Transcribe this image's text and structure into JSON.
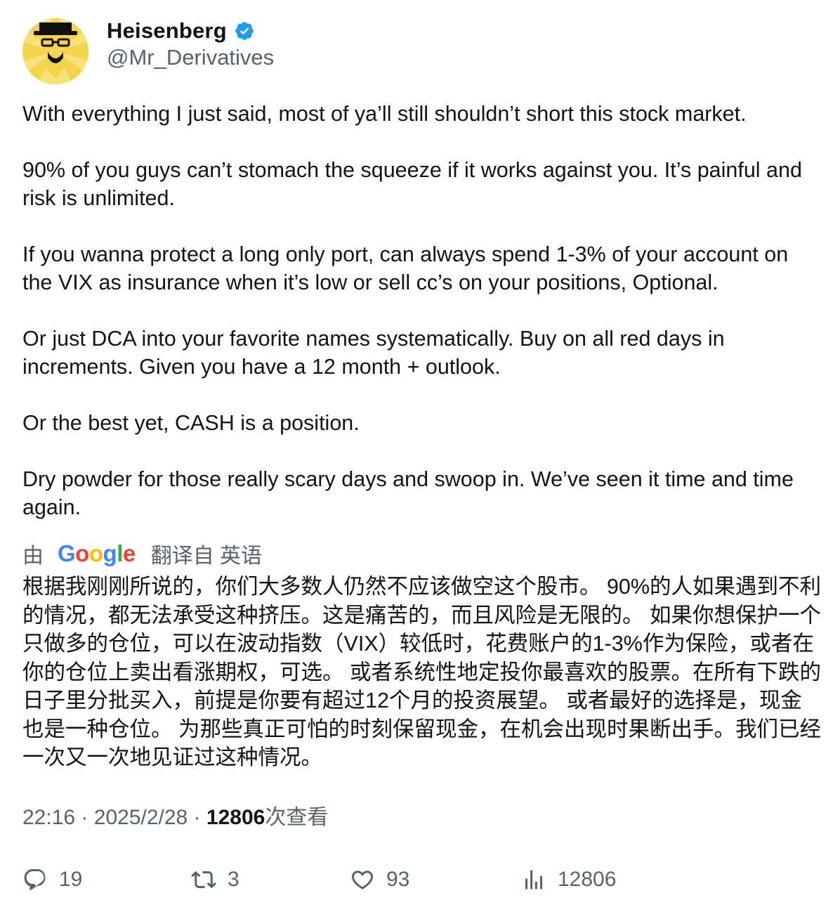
{
  "author": {
    "display_name": "Heisenberg",
    "handle": "@Mr_Derivatives",
    "verified": true,
    "verified_color": "#1d9bf0",
    "avatar_icon": "heisenberg-avatar"
  },
  "tweet": {
    "text": "With everything I just said, most of ya’ll still shouldn’t short this stock market.\n\n90% of you guys can’t stomach the squeeze if it works against you. It’s painful and risk is unlimited.\n\nIf you wanna protect a long only port, can always spend 1-3% of your account on the VIX as insurance when it’s low or sell cc’s on your positions, Optional.\n\nOr just DCA into your favorite names systematically. Buy on all red days in increments. Given you have a 12 month + outlook.\n\nOr the best yet, CASH is a position.\n\nDry powder for those really scary days and swoop in. We’ve seen it time and time again."
  },
  "translation": {
    "by_label": "由",
    "provider": "Google",
    "label": "翻译自 英语",
    "text": "根据我刚刚所说的，你们大多数人仍然不应该做空这个股市。 90%的人如果遇到不利的情况，都无法承受这种挤压。这是痛苦的，而且风险是无限的。 如果你想保护一个只做多的仓位，可以在波动指数（VIX）较低时，花费账户的1-3%作为保险，或者在你的仓位上卖出看涨期权，可选。 或者系统性地定投你最喜欢的股票。在所有下跌的日子里分批买入，前提是你要有超过12个月的投资展望。 或者最好的选择是，现金也是一种仓位。 为那些真正可怕的时刻保留现金，在机会出现时果断出手。我们已经一次又一次地见证过这种情况。"
  },
  "meta": {
    "time": "22:16",
    "separator": "·",
    "date": "2025/2/28",
    "views_count": "12806",
    "views_label": "次查看"
  },
  "actions": {
    "reply_count": "19",
    "retweet_count": "3",
    "like_count": "93",
    "views_count": "12806",
    "icons": [
      "reply-icon",
      "retweet-icon",
      "like-icon",
      "views-icon"
    ]
  }
}
